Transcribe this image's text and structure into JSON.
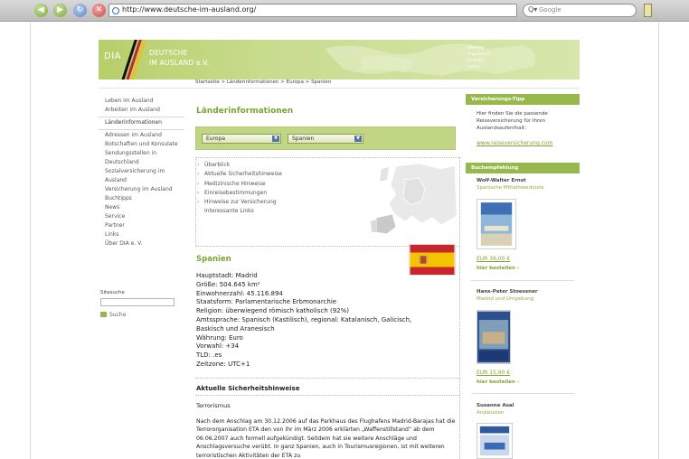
{
  "browser": {
    "url": "http://www.deutsche-im-ausland.org/",
    "search_placeholder": "Google",
    "search_engine_glyph": "Q▾"
  },
  "header": {
    "logo_abbr": "DIA",
    "logo_line1": "DEUTSCHE",
    "logo_line2": "IM AUSLAND e.V.",
    "top_links": [
      "Sitemap",
      "Impressum",
      "Kontakt",
      "Home"
    ]
  },
  "breadcrumb": "Startseite > Länderinformationen > Europa > Spanien",
  "left_nav": {
    "items": [
      "Leben im Ausland",
      "Arbeiten im Ausland"
    ],
    "section": "Länderinformationen",
    "items2": [
      "Adressen im Ausland",
      "Botschaften und Konsulate",
      "Sendungsstellen in",
      "Deutschland",
      "Sozialversicherung im",
      "Ausland",
      "Versicherung im Ausland",
      "Buchtipps",
      "News",
      "Service",
      "Partner",
      "Links",
      "Über DIA e. V."
    ],
    "search_label": "Sitesuche",
    "search_button": "Suche"
  },
  "main": {
    "title": "Länderinformationen",
    "select_region": "Europa",
    "select_country": "Spanien",
    "toc": [
      "Überblick",
      "Aktuelle Sicherheitshinweise",
      "Medizinische Hinweise",
      "Einreisebestimmungen",
      "Hinweise zur Versicherung",
      "Interessante Links"
    ],
    "country": "Spanien",
    "facts": [
      "Hauptstadt: Madrid",
      "Größe: 504.645 km²",
      "Einwohnerzahl: 45.116.894",
      "Staatsform: Parlamentarische Erbmonarchie",
      "Religion: überwiegend römisch katholisch (92%)",
      "Amtssprache: Spanisch (Kastilisch), regional: Katalanisch, Galicisch,",
      "Baskisch und Aranesisch",
      "Währung: Euro",
      "Vorwahl: +34",
      "TLD: .es",
      "Zeitzone: UTC+1"
    ],
    "security_heading": "Aktuelle Sicherheitshinweise",
    "security_sub": "Terrorismus",
    "security_text": "Nach dem Anschlag am 30.12.2006 auf das Parkhaus des Flughafens Madrid-Barajas hat die Terrororganisation ETA den von ihr im März 2006 erklärten „Waffenstillstand“ ab dem 06.06.2007 auch formell aufgekündigt. Seitdem hat sie weitere Anschläge und Anschlagsversuche verübt. In ganz Spanien, auch in Tourismusregionen, ist mit weiteren terroristischen Aktivitäten der ETA zu"
  },
  "right": {
    "tip_title": "Versicherungs-Tipp",
    "tip_text": [
      "Hier finden Sie die passende",
      "Reiseversicherung für Ihren",
      "Auslandsaufenthalt:"
    ],
    "tip_link": "www.reiseversicherung.com",
    "book_title": "Buchempfehlung",
    "books": [
      {
        "author": "Wolf-Walter Ernst",
        "title": "Spanische Mittelmeerküste",
        "price": "EUR 36,00 €",
        "order": "hier bestellen ›"
      },
      {
        "author": "Hans-Peter Stoessner",
        "title": "Madrid und Umgebung",
        "price": "EUR 15,90 €",
        "order": "hier bestellen ›"
      },
      {
        "author": "Susanne Asal",
        "title": "Andalusien"
      }
    ]
  }
}
